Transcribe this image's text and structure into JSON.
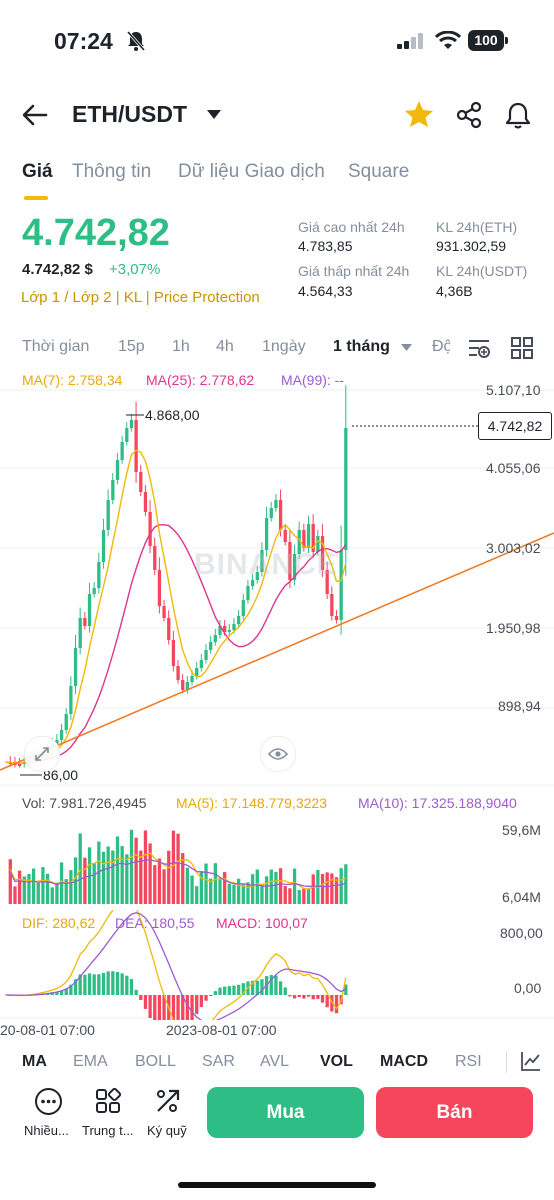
{
  "status": {
    "time": "07:24",
    "battery": "100"
  },
  "header": {
    "pair": "ETH/USDT"
  },
  "tabs": [
    "Giá",
    "Thông tin",
    "Dữ liệu Giao dịch",
    "Square"
  ],
  "price": {
    "last": "4.742,82",
    "fiat": "4.742,82 $",
    "change": "+3,07%",
    "tags": [
      "Lớp 1 / Lớp 2",
      "KL",
      "Price Protection"
    ]
  },
  "stats": {
    "high_label": "Giá cao nhất 24h",
    "high": "4.783,85",
    "low_label": "Giá thấp nhất 24h",
    "low": "4.564,33",
    "vol_base_label": "KL 24h(ETH)",
    "vol_base": "931.302,59",
    "vol_quote_label": "KL 24h(USDT)",
    "vol_quote": "4,36B"
  },
  "timeframes": [
    "Thời gian",
    "15p",
    "1h",
    "4h",
    "1ngày",
    "1 tháng",
    "Độ"
  ],
  "ma_main": {
    "ma7": "MA(7): 2.758,34",
    "ma25": "MA(25): 2.778,62",
    "ma99": "MA(99): --"
  },
  "price_axis": [
    "5.107,10",
    "4.055,06",
    "3.003,02",
    "1.950,98",
    "898,94"
  ],
  "chart_marks": {
    "high": "4.868,00",
    "low": "86,00",
    "last": "4.742,82"
  },
  "watermark": "BINANCE",
  "volume": {
    "vol": "Vol: 7.981.726,4945",
    "ma5": "MA(5): 17.148.779,3223",
    "ma10": "MA(10): 17.325.188,9040",
    "axis_top": "59,6M",
    "axis_bottom": "6,04M"
  },
  "macd": {
    "dif": "DIF: 280,62",
    "dea": "DEA: 180,55",
    "macd": "MACD: 100,07",
    "axis_top": "800,00",
    "axis_zero": "0,00"
  },
  "time_axis": [
    "20-08-01 07:00",
    "2023-08-01 07:00"
  ],
  "indicator_tabs": [
    "MA",
    "EMA",
    "BOLL",
    "SAR",
    "AVL",
    "VOL",
    "MACD",
    "RSI"
  ],
  "actions": {
    "more": "Nhiều...",
    "center": "Trung t...",
    "margin": "Ký quỹ",
    "buy": "Mua",
    "sell": "Bán"
  },
  "colors": {
    "up": "#2ebd85",
    "down": "#f6465d",
    "accent": "#f0b90b",
    "ma7": "#f0b90b",
    "ma25": "#e0338e",
    "ma99": "#9c5bd2"
  }
}
